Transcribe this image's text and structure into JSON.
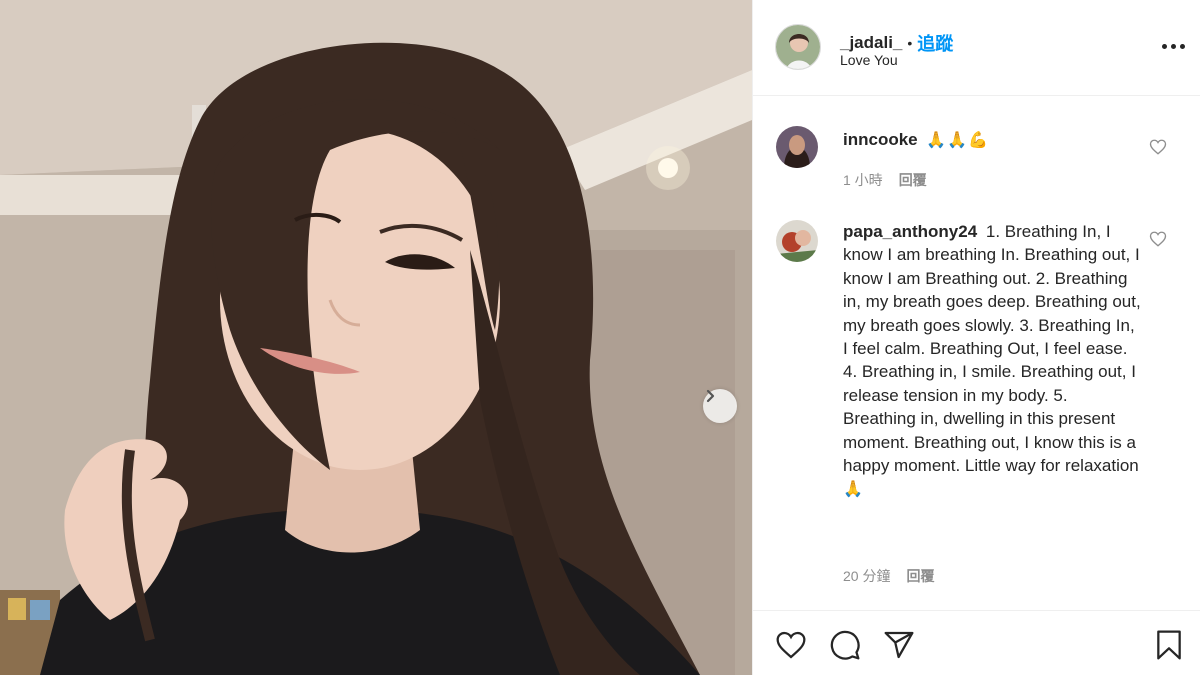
{
  "post": {
    "author": "_jadali_",
    "separator": "•",
    "follow_label": "追蹤",
    "location": "Love You",
    "more_icon": "more-options-icon",
    "photo_next_icon": "chevron-right-icon"
  },
  "comments": [
    {
      "username": "inncooke",
      "text": "",
      "emoji": "🙏🙏💪",
      "time": "1 小時",
      "reply_label": "回覆"
    },
    {
      "username": "papa_anthony24",
      "text": "1. Breathing In, I know I am breathing In. Breathing out, I know I am Breathing out. 2. Breathing in, my breath goes deep. Breathing out, my breath goes slowly. 3. Breathing In, I feel calm. Breathing Out, I feel ease. 4. Breathing in, I smile. Breathing out, I release tension in my body. 5. Breathing in, dwelling in this present moment. Breathing out, I know this is a happy moment. Little way for relaxation",
      "emoji": "🙏",
      "time": "20 分鐘",
      "reply_label": "回覆"
    }
  ],
  "actions": {
    "like_icon": "heart-icon",
    "comment_icon": "comment-icon",
    "share_icon": "share-icon",
    "save_icon": "bookmark-icon"
  },
  "colors": {
    "follow": "#0095f6",
    "text": "#262626",
    "muted": "#8e8e8e",
    "divider": "#efefef"
  }
}
